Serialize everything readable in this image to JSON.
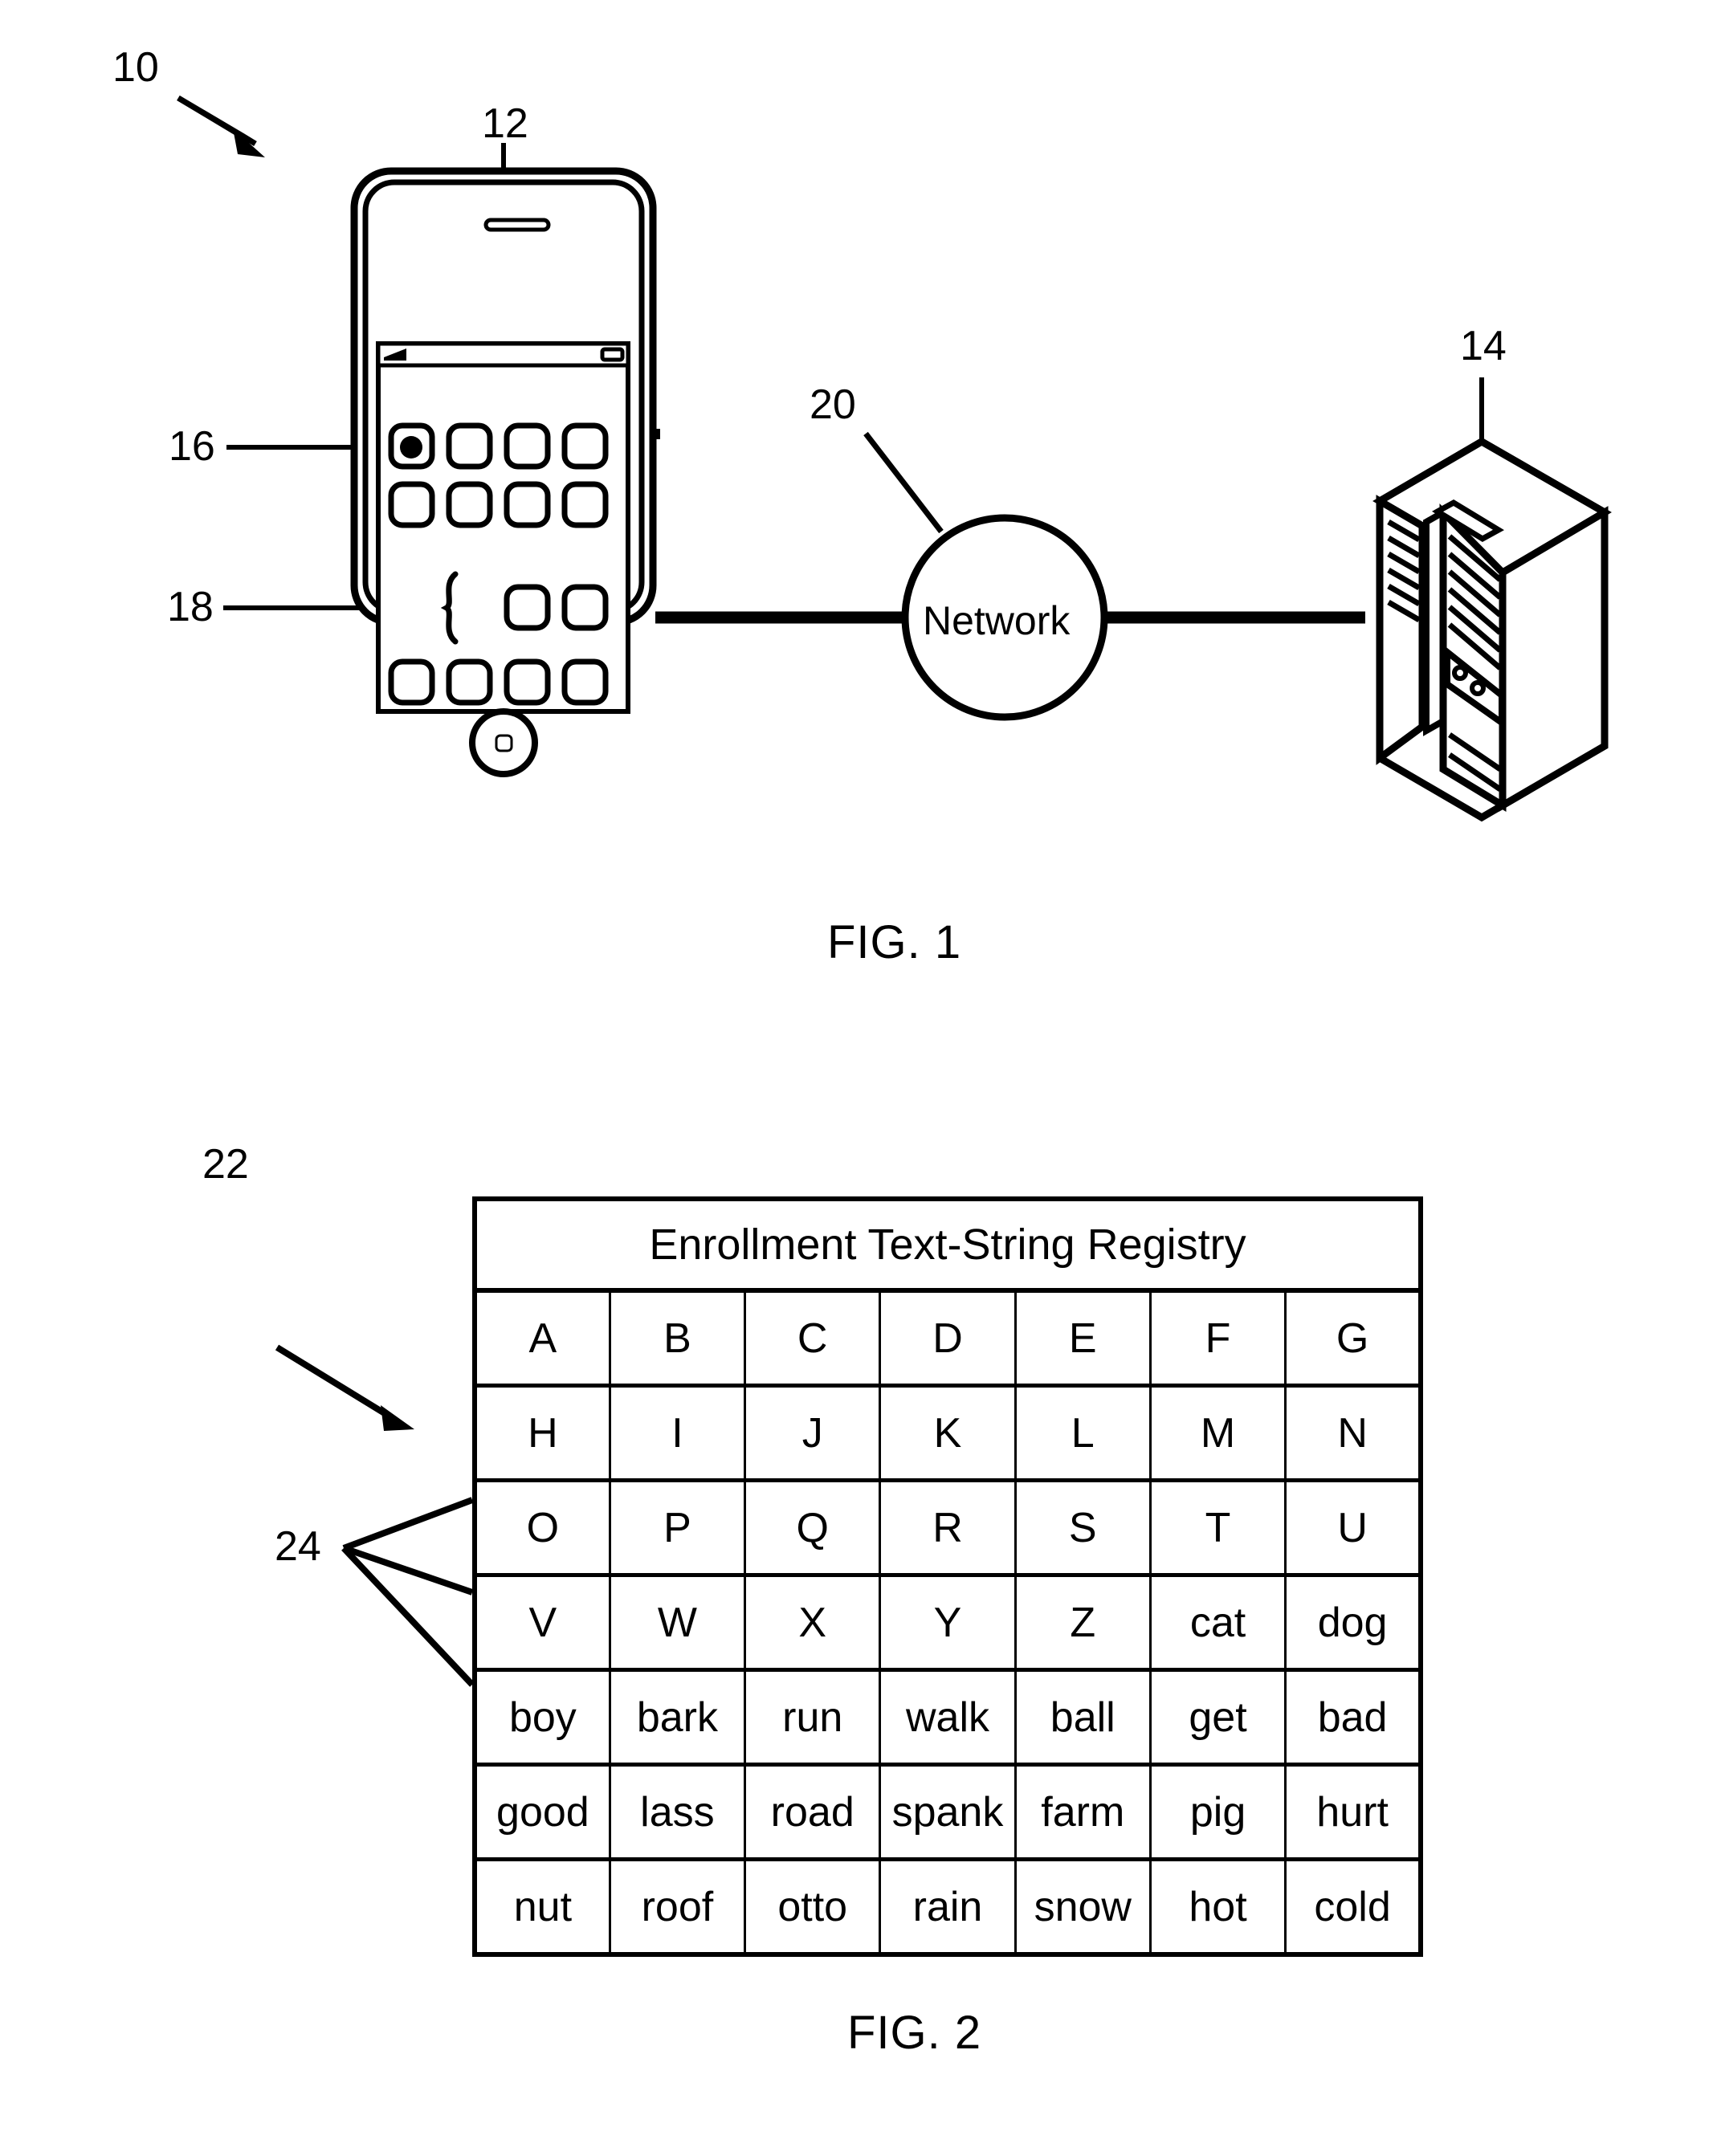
{
  "figure1": {
    "caption": "FIG. 1",
    "network_label": "Network",
    "ref_system": "10",
    "ref_device": "12",
    "ref_server": "14",
    "ref_icon": "16",
    "ref_brace": "18",
    "ref_network": "20"
  },
  "figure2": {
    "caption": "FIG. 2",
    "ref_registry": "22",
    "ref_entries": "24",
    "table": {
      "title": "Enrollment Text-String Registry",
      "rows": [
        [
          "A",
          "B",
          "C",
          "D",
          "E",
          "F",
          "G"
        ],
        [
          "H",
          "I",
          "J",
          "K",
          "L",
          "M",
          "N"
        ],
        [
          "O",
          "P",
          "Q",
          "R",
          "S",
          "T",
          "U"
        ],
        [
          "V",
          "W",
          "X",
          "Y",
          "Z",
          "cat",
          "dog"
        ],
        [
          "boy",
          "bark",
          "run",
          "walk",
          "ball",
          "get",
          "bad"
        ],
        [
          "good",
          "lass",
          "road",
          "spank",
          "farm",
          "pig",
          "hurt"
        ],
        [
          "nut",
          "roof",
          "otto",
          "rain",
          "snow",
          "hot",
          "cold"
        ]
      ]
    }
  }
}
